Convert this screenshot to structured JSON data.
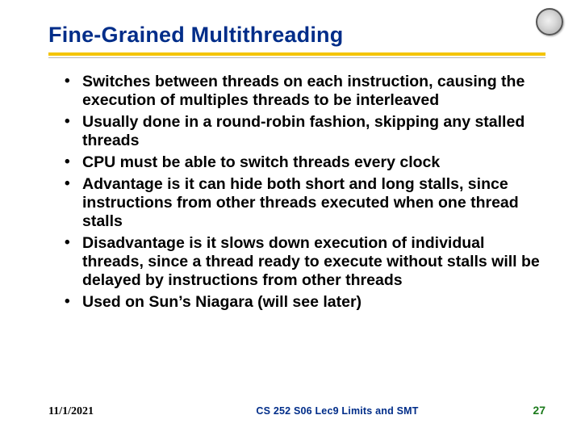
{
  "title": "Fine-Grained Multithreading",
  "bullets": [
    "Switches between threads on each instruction, causing the execution of multiples threads to be interleaved",
    "Usually done in a round-robin fashion, skipping any stalled threads",
    "CPU must be able to switch threads every clock",
    "Advantage is it can hide both short and long stalls, since instructions from other threads executed when one thread stalls",
    "Disadvantage is it slows down execution of individual threads, since a thread ready to execute without stalls will be delayed by instructions from other threads",
    "Used on Sun’s Niagara (will see later)"
  ],
  "footer": {
    "date": "11/1/2021",
    "course": "CS 252 S06 Lec9 Limits and SMT",
    "slide_number": "27"
  }
}
